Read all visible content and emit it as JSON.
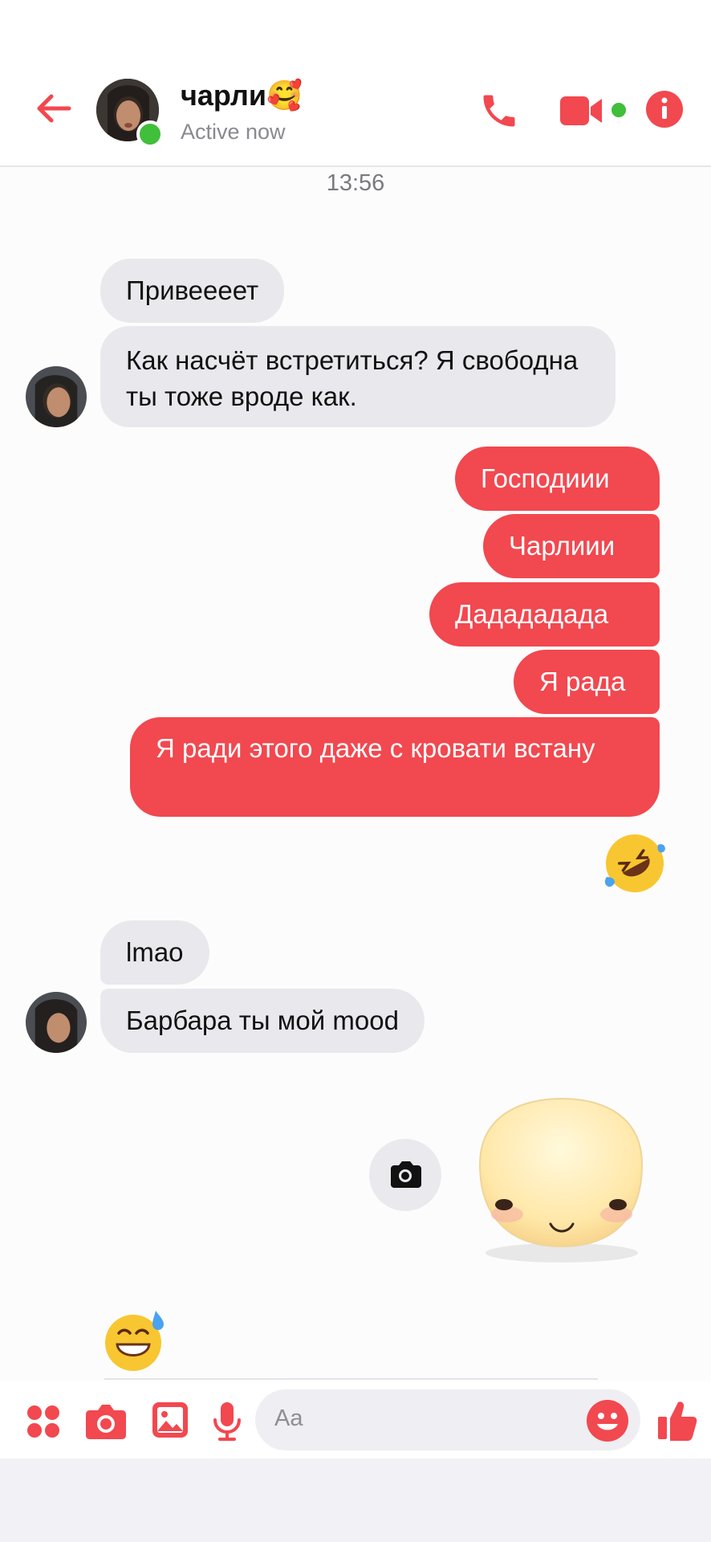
{
  "header": {
    "contact_name": "чарли🥰",
    "status": "Active now",
    "accent_color": "#f2484f",
    "icons": [
      "back-arrow-icon",
      "phone-icon",
      "video-call-icon",
      "info-icon"
    ]
  },
  "conversation": {
    "timestamp": "13:56",
    "messages": [
      {
        "from": "contact",
        "text": "Привеееет"
      },
      {
        "from": "contact",
        "text": "Как насчёт встретиться? Я свободна ты тоже вроде как."
      },
      {
        "from": "me",
        "text": "Господиии"
      },
      {
        "from": "me",
        "text": "Чарлиии"
      },
      {
        "from": "me",
        "text": "Дадададада"
      },
      {
        "from": "me",
        "text": "Я рада"
      },
      {
        "from": "me",
        "text": "Я ради этого даже с кровати встану"
      },
      {
        "from": "me",
        "emoji": "rolling-on-floor-laughing"
      },
      {
        "from": "contact",
        "text": "lmao"
      },
      {
        "from": "contact",
        "text": "Барбара ты мой mood"
      },
      {
        "from": "me",
        "sticker": "blushing-blob-face"
      },
      {
        "from": "contact",
        "emoji": "grinning-sweat"
      }
    ]
  },
  "composer": {
    "placeholder": "Aa",
    "icons": [
      "apps-icon",
      "camera-icon",
      "gallery-icon",
      "microphone-icon",
      "emoji-icon",
      "thumbs-up-icon"
    ]
  }
}
